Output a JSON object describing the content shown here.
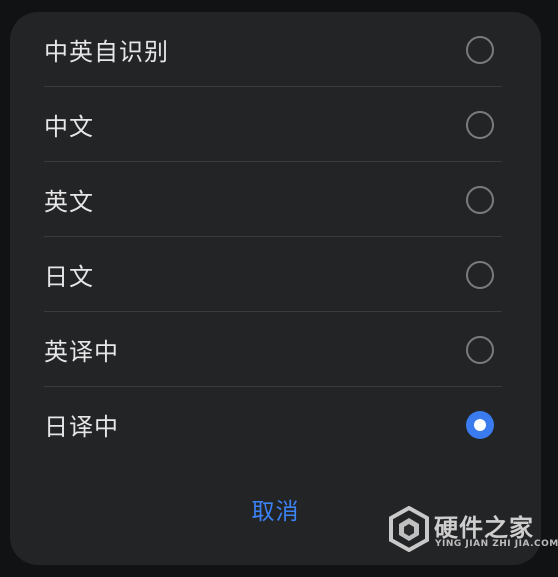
{
  "dialog": {
    "options": [
      {
        "label": "中英自识别",
        "selected": false
      },
      {
        "label": "中文",
        "selected": false
      },
      {
        "label": "英文",
        "selected": false
      },
      {
        "label": "日文",
        "selected": false
      },
      {
        "label": "英译中",
        "selected": false
      },
      {
        "label": "日译中",
        "selected": true
      }
    ],
    "cancel_label": "取消"
  },
  "watermark": {
    "name": "硬件之家",
    "subtitle": "YING JIAN ZHI JIA.COM"
  },
  "colors": {
    "sheet_background": "#232426",
    "accent": "#3a7cf0",
    "cancel_text": "#3b82f6",
    "label_text": "#e6e6e6"
  }
}
